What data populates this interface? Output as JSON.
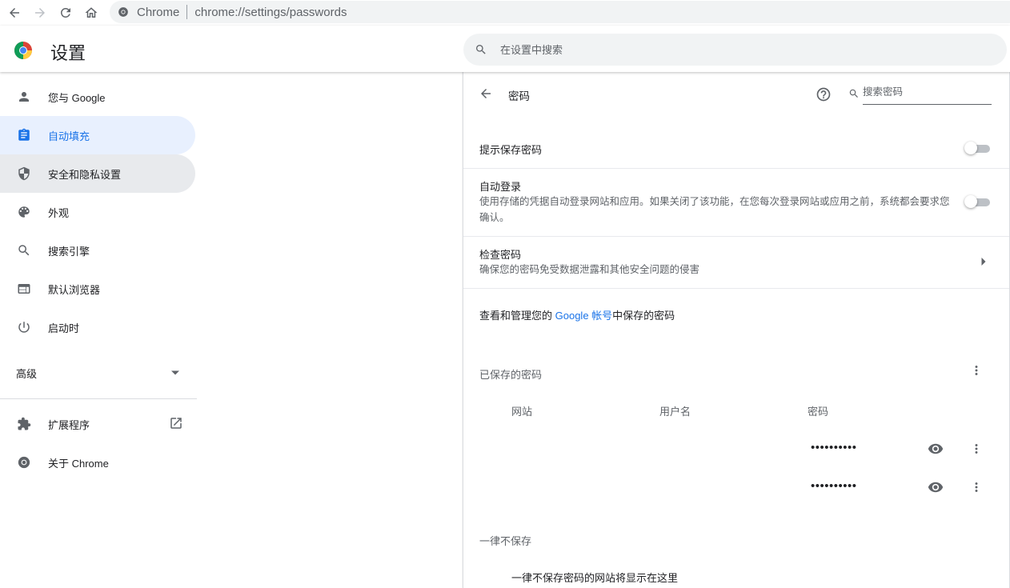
{
  "browser": {
    "omnibox_site": "Chrome",
    "omnibox_url": "chrome://settings/passwords"
  },
  "header": {
    "title": "设置",
    "search_placeholder": "在设置中搜索"
  },
  "sidebar": {
    "items": [
      {
        "label": "您与 Google",
        "icon": "person-icon"
      },
      {
        "label": "自动填充",
        "icon": "assignment-icon",
        "active": true
      },
      {
        "label": "安全和隐私设置",
        "icon": "shield-icon"
      },
      {
        "label": "外观",
        "icon": "palette-icon"
      },
      {
        "label": "搜索引擎",
        "icon": "search-icon"
      },
      {
        "label": "默认浏览器",
        "icon": "browser-icon"
      },
      {
        "label": "启动时",
        "icon": "power-icon"
      }
    ],
    "advanced_label": "高级",
    "extensions_label": "扩展程序",
    "about_label": "关于 Chrome"
  },
  "passwords": {
    "page_title": "密码",
    "search_placeholder": "搜索密码",
    "offer_to_save": {
      "label": "提示保存密码",
      "enabled": false
    },
    "auto_signin": {
      "label": "自动登录",
      "description": "使用存储的凭据自动登录网站和应用。如果关闭了该功能，在您每次登录网站或应用之前，系统都会要求您确认。",
      "enabled": false
    },
    "check_passwords": {
      "label": "检查密码",
      "description": "确保您的密码免受数据泄露和其他安全问题的侵害"
    },
    "manage_prefix": "查看和管理您的 ",
    "manage_link": "Google 帐号",
    "manage_suffix": "中保存的密码",
    "saved_title": "已保存的密码",
    "columns": {
      "website": "网站",
      "username": "用户名",
      "password": "密码"
    },
    "entries": [
      {
        "website": "",
        "username": "",
        "password": "••••••••••"
      },
      {
        "website": "",
        "username": "",
        "password": "••••••••••"
      }
    ],
    "never_saved_title": "一律不保存",
    "never_saved_empty": "一律不保存密码的网站将显示在这里"
  },
  "colors": {
    "accent": "#1a73e8",
    "active_bg": "#e8f0fe",
    "text": "#202124",
    "secondary": "#5f6368"
  }
}
